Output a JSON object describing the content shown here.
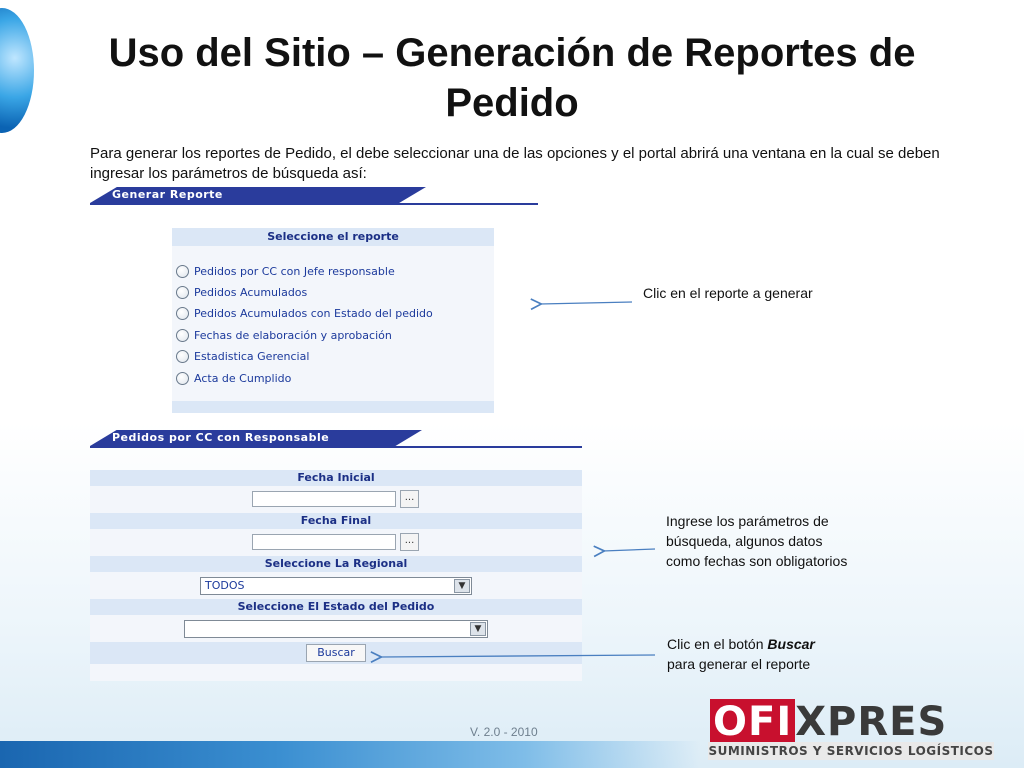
{
  "slide": {
    "title": "Uso del Sitio – Generación de Reportes de Pedido",
    "intro": "Para generar los reportes de Pedido, el debe seleccionar una de las opciones y el portal abrirá una ventana en la cual se deben ingresar los parámetros de búsqueda así:",
    "version": "V. 2.0 - 2010"
  },
  "report_panel": {
    "header_tab": "Generar Reporte",
    "title": "Seleccione el reporte",
    "options": [
      "Pedidos por CC con Jefe responsable",
      "Pedidos Acumulados",
      "Pedidos Acumulados con Estado del pedido",
      "Fechas de elaboración y aprobación",
      "Estadistica Gerencial",
      "Acta de Cumplido"
    ]
  },
  "search_form": {
    "header_tab": "Pedidos por CC con Responsable",
    "fecha_inicial_label": "Fecha Inicial",
    "fecha_inicial_value": "",
    "fecha_final_label": "Fecha Final",
    "fecha_final_value": "",
    "date_picker_label": "...",
    "regional_label": "Seleccione La Regional",
    "regional_selected": "TODOS",
    "estado_label": "Seleccione El Estado del Pedido",
    "estado_selected": "",
    "search_button": "Buscar"
  },
  "notes": {
    "report_click": "Clic en el reporte a generar",
    "parameters": "Ingrese los parámetros de búsqueda, algunos datos como fechas son obligatorios",
    "buscar_prefix": "Clic en el botón ",
    "buscar_emph": "Buscar",
    "buscar_suffix": "para generar el reporte"
  },
  "logo": {
    "brand_red": "OFI",
    "brand_dark": "XPRES",
    "tagline": "SUMINISTROS Y SERVICIOS LOGÍSTICOS"
  },
  "colors": {
    "header_blue": "#2a3c9c",
    "label_blue": "#1b2f85",
    "panel_bg": "#f3f6fb",
    "row_bg": "#dbe7f6",
    "arrow_blue": "#4a7fc0",
    "logo_red": "#c8102e"
  }
}
